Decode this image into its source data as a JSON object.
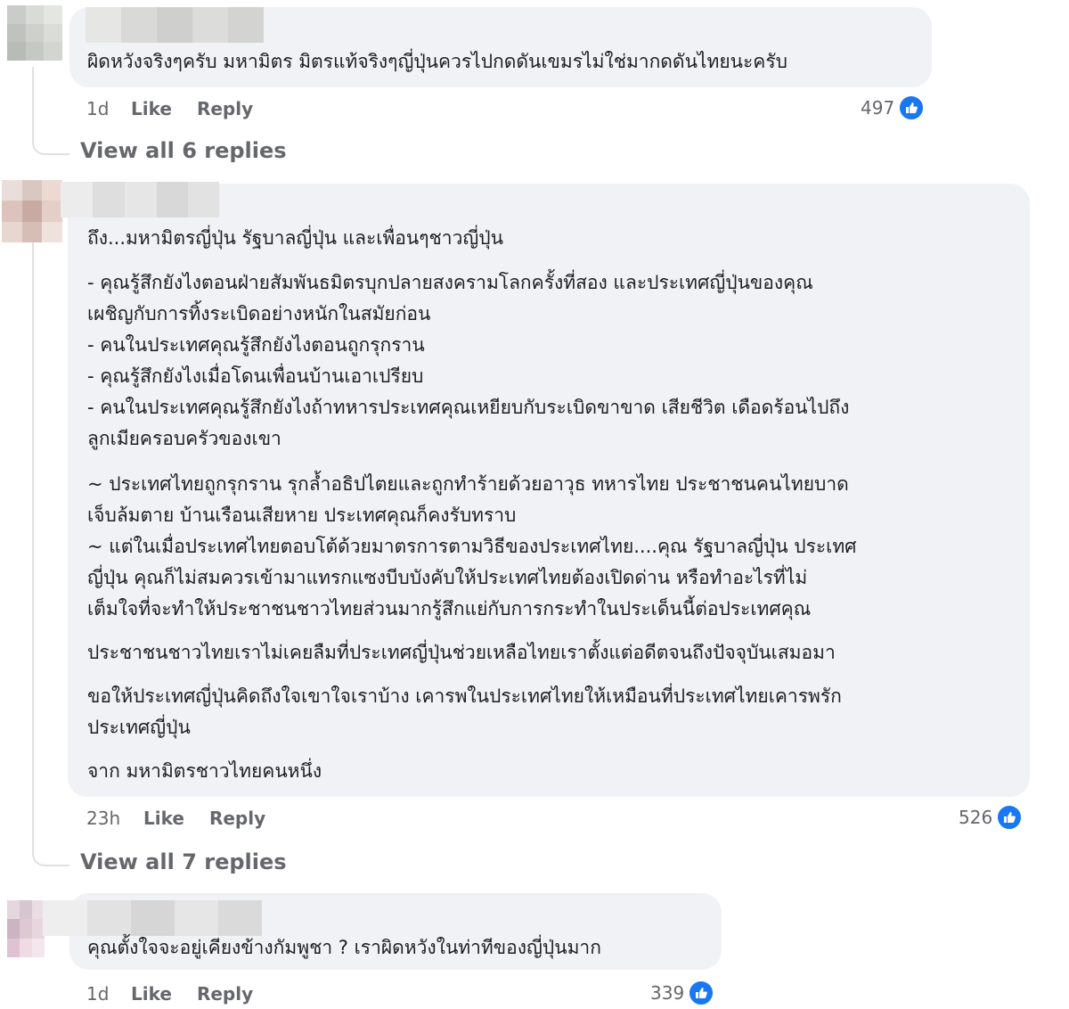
{
  "comments": [
    {
      "lines": [
        "ผิดหวังจริงๆครับ มหามิตร มิตรแท้จริงๆญี่ปุ่นควรไปกดดันเขมรไม่ใช่มากดดันไทยนะครับ"
      ],
      "time": "1d",
      "like_label": "Like",
      "reply_label": "Reply",
      "reaction_count": "497",
      "view_replies": "View all 6 replies"
    },
    {
      "lines": [
        "ถึง...มหามิตรญี่ปุ่น รัฐบาลญี่ปุ่น และเพื่อนๆชาวญี่ปุ่น",
        "- คุณรู้สึกยังไงตอนฝ่ายสัมพันธมิตรบุกปลายสงครามโลกครั้งที่สอง และประเทศญี่ปุ่นของคุณ",
        "เผชิญกับการทิ้งระเบิดอย่างหนักในสมัยก่อน",
        "- คนในประเทศคุณรู้สึกยังไงตอนถูกรุกราน",
        "- คุณรู้สึกยังไงเมื่อโดนเพื่อนบ้านเอาเปรียบ",
        "- คนในประเทศคุณรู้สึกยังไงถ้าทหารประเทศคุณเหยียบกับระเบิดขาขาด เสียชีวิต เดือดร้อนไปถึง",
        "ลูกเมียครอบครัวของเขา",
        "~ ประเทศไทยถูกรุกราน รุกล้ำอธิปไตยและถูกทำร้ายด้วยอาวุธ ทหารไทย ประชาชนคนไทยบาด",
        "เจ็บล้มตาย บ้านเรือนเสียหาย ประเทศคุณก็คงรับทราบ",
        "~ แต่ในเมื่อประเทศไทยตอบโต้ด้วยมาตรการตามวิธีของประเทศไทย....คุณ รัฐบาลญี่ปุ่น ประเทศ",
        "ญี่ปุ่น คุณก็ไม่สมควรเข้ามาแทรกแซงบีบบังคับให้ประเทศไทยต้องเปิดด่าน หรือทำอะไรที่ไม่",
        "เต็มใจที่จะทำให้ประชาชนชาวไทยส่วนมากรู้สึกแย่กับการกระทำในประเด็นนี้ต่อประเทศคุณ",
        "ประชาชนชาวไทยเราไม่เคยลืมที่ประเทศญี่ปุ่นช่วยเหลือไทยเราตั้งแต่อดีตจนถึงปัจจุบันเสมอมา",
        "ขอให้ประเทศญี่ปุ่นคิดถึงใจเขาใจเราบ้าง เคารพในประเทศไทยให้เหมือนที่ประเทศไทยเคารพรัก",
        "ประเทศญี่ปุ่น",
        "จาก มหามิตรชาวไทยคนหนึ่ง"
      ],
      "time": "23h",
      "like_label": "Like",
      "reply_label": "Reply",
      "reaction_count": "526",
      "view_replies": "View all 7 replies"
    },
    {
      "lines": [
        "คุณตั้งใจจะอยู่เคียงข้างกัมพูชา ? เราผิดหวังในท่าทีของญี่ปุ่นมาก"
      ],
      "time": "1d",
      "like_label": "Like",
      "reply_label": "Reply",
      "reaction_count": "339"
    }
  ],
  "colors": {
    "bubble": "#f0f2f5",
    "meta_text": "#65676b",
    "like_blue": "#1877f2"
  },
  "icons": {
    "reaction": "thumbs-up-icon"
  }
}
